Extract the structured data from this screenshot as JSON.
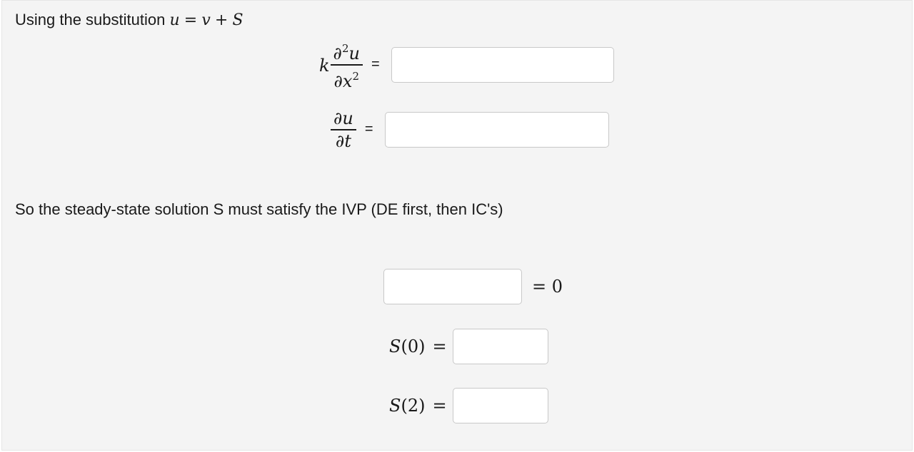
{
  "intro": {
    "text": "Using the substitution",
    "var_u": "u",
    "equals": "=",
    "var_v": "v",
    "plus": "+",
    "var_S": "S"
  },
  "equation1": {
    "coefficient": "k",
    "numerator_partial": "∂",
    "numerator_power": "2",
    "numerator_var": "u",
    "denominator_partial": "∂",
    "denominator_var": "x",
    "denominator_power": "2",
    "equals": "=",
    "answer_value": ""
  },
  "equation2": {
    "numerator_partial": "∂",
    "numerator_var": "u",
    "denominator_partial": "∂",
    "denominator_var": "t",
    "equals": "=",
    "answer_value": ""
  },
  "statement": "So the steady-state solution S must satisfy the IVP (DE first, then IC's)",
  "ivp": {
    "de_answer_value": "",
    "de_rhs": "= 0",
    "ic1_func": "S",
    "ic1_arg": "(0)",
    "ic1_equals": "=",
    "ic1_answer_value": "",
    "ic2_func": "S",
    "ic2_arg": "(2)",
    "ic2_equals": "=",
    "ic2_answer_value": ""
  }
}
